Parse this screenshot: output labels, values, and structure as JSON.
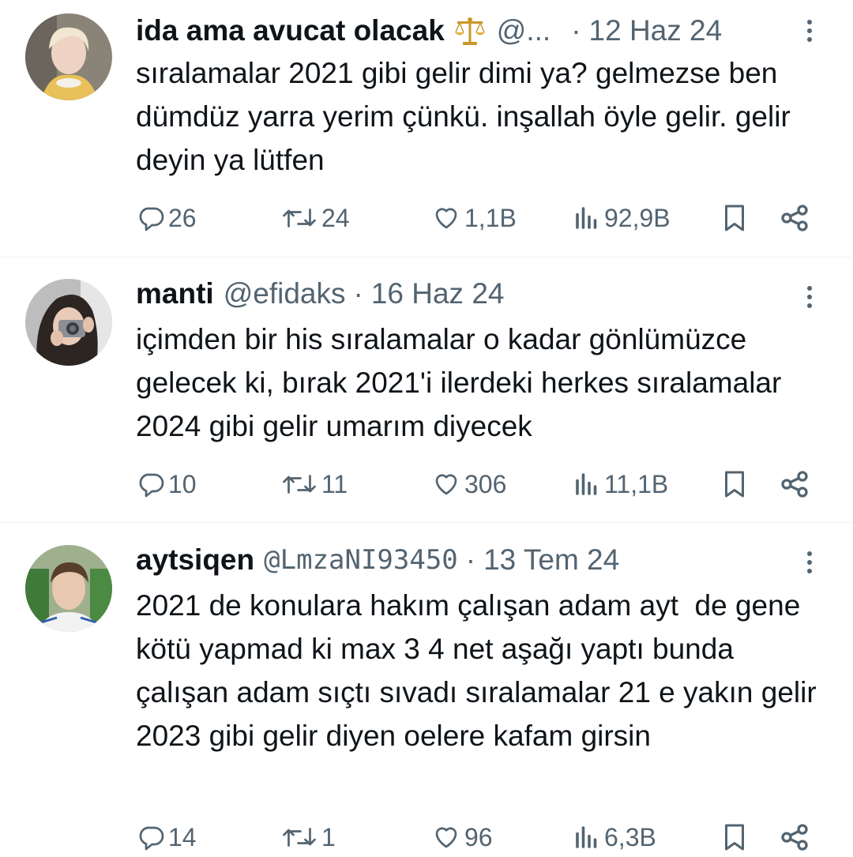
{
  "tweets": [
    {
      "name": "ida ama avucat olacak",
      "badge_icon": "scales-icon",
      "handle": "@...",
      "separator": "·",
      "time": "12 Haz 24",
      "text": "sıralamalar 2021 gibi gelir dimi ya? gelmezse ben dümdüz yarra yerim çünkü. inşallah öyle gelir. gelir deyin ya lütfen",
      "replies": "26",
      "retweets": "24",
      "likes": "1,1B",
      "views": "92,9B"
    },
    {
      "name": "manti",
      "handle": "@efidaks",
      "separator": "·",
      "time": "16 Haz 24",
      "text": "içimden bir his sıralamalar o kadar gönlümüzce gelecek ki, bırak 2021'i ilerdeki herkes sıralamalar 2024 gibi gelir umarım diyecek",
      "replies": "10",
      "retweets": "11",
      "likes": "306",
      "views": "11,1B"
    },
    {
      "name": "aytsiqen",
      "handle": "@LmzaNI93450",
      "separator": "·",
      "time": "13 Tem 24",
      "text": "2021 de konulara hakım çalışan adam ayt  de gene kötü yapmad ki max 3 4 net aşağı yaptı bunda çalışan adam sıçtı sıvadı sıralamalar 21 e yakın gelir 2023 gibi gelir diyen oelere kafam girsin",
      "replies": "14",
      "retweets": "1",
      "likes": "96",
      "views": "6,3B"
    }
  ],
  "colors": {
    "text": "#0f1419",
    "secondary": "#536471",
    "divider": "#eff3f4"
  }
}
